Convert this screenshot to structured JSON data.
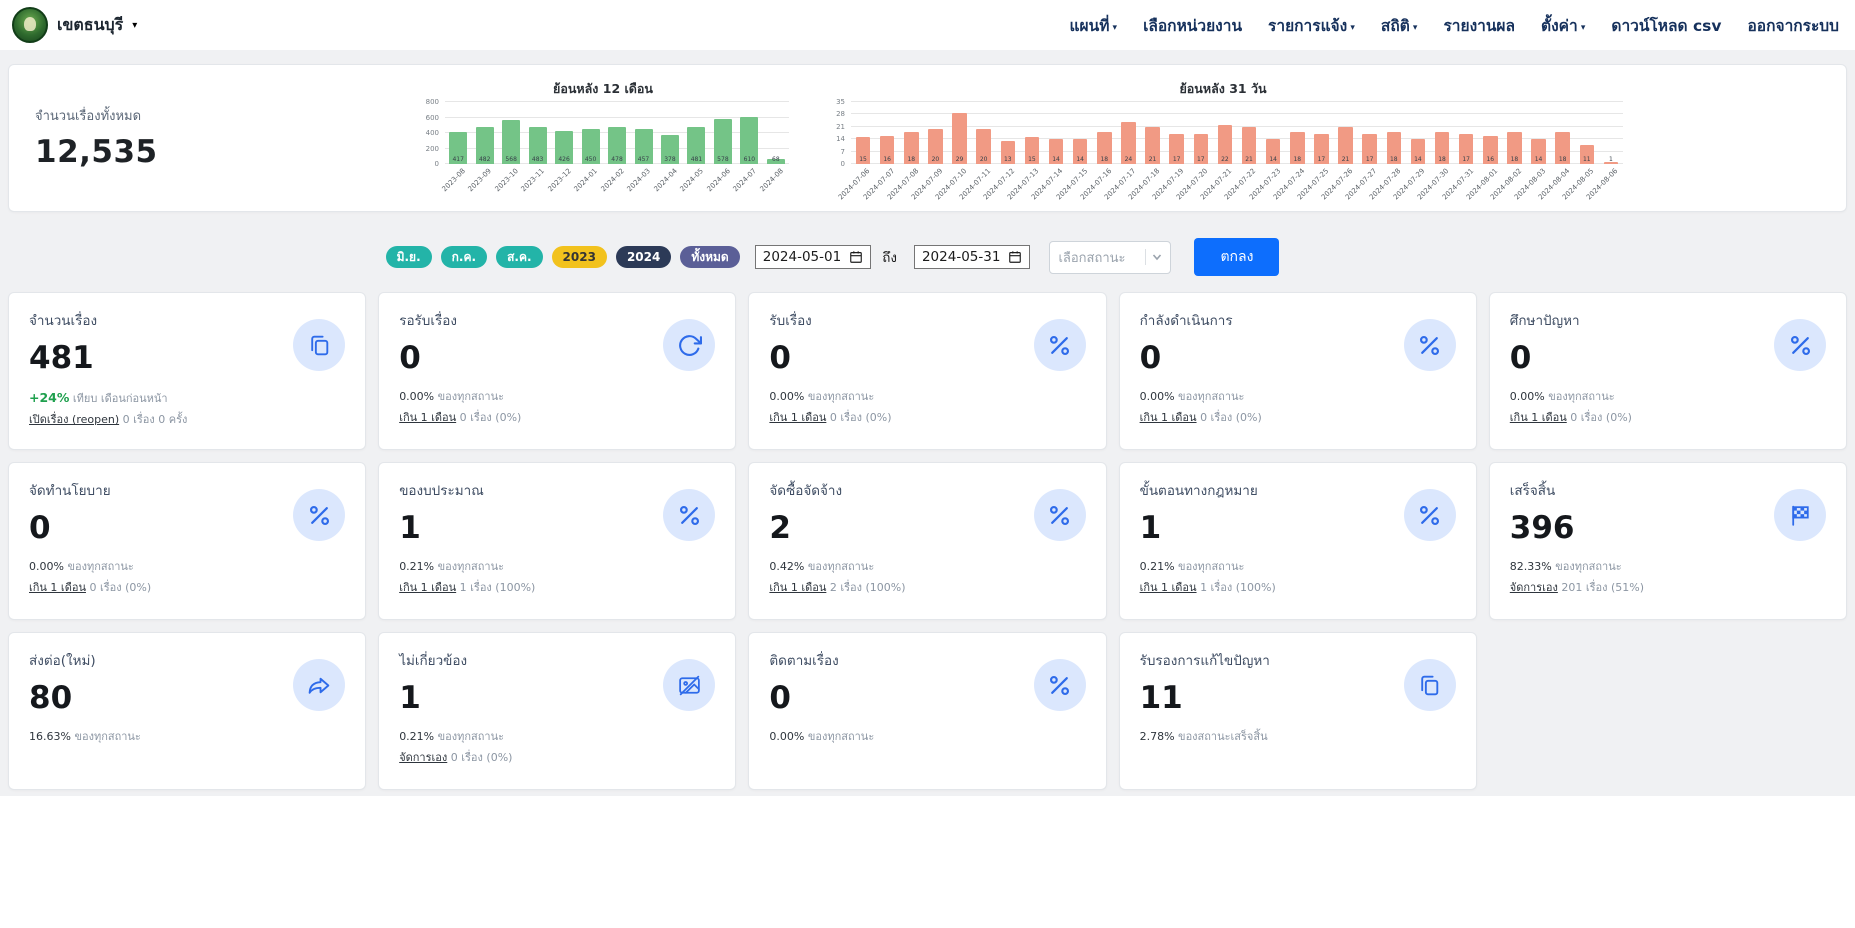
{
  "navbar": {
    "brand": "เขตธนบุรี",
    "items": [
      {
        "label": "แผนที่",
        "caret": true
      },
      {
        "label": "เลือกหน่วยงาน",
        "caret": false
      },
      {
        "label": "รายการแจ้ง",
        "caret": true
      },
      {
        "label": "สถิติ",
        "caret": true
      },
      {
        "label": "รายงานผล",
        "caret": false
      },
      {
        "label": "ตั้งค่า",
        "caret": true
      },
      {
        "label": "ดาวน์โหลด csv",
        "caret": false
      },
      {
        "label": "ออกจากระบบ",
        "caret": false
      }
    ]
  },
  "overview": {
    "total_label": "จำนวนเรื่องทั้งหมด",
    "total_value": "12,535"
  },
  "chart_data": [
    {
      "type": "bar",
      "title": "ย้อนหลัง 12 เดือน",
      "categories": [
        "2023-08",
        "2023-09",
        "2023-10",
        "2023-11",
        "2023-12",
        "2024-01",
        "2024-02",
        "2024-03",
        "2024-04",
        "2024-05",
        "2024-06",
        "2024-07",
        "2024-08"
      ],
      "values": [
        417,
        482,
        568,
        483,
        426,
        450,
        478,
        457,
        378,
        481,
        578,
        610,
        68
      ],
      "ylim": [
        0,
        800
      ],
      "yticks": [
        0,
        200,
        400,
        600,
        800
      ],
      "color": "#74c487",
      "grid": true,
      "legend": "none"
    },
    {
      "type": "bar",
      "title": "ย้อนหลัง 31 วัน",
      "categories": [
        "2024-07-06",
        "2024-07-07",
        "2024-07-08",
        "2024-07-09",
        "2024-07-10",
        "2024-07-11",
        "2024-07-12",
        "2024-07-13",
        "2024-07-14",
        "2024-07-15",
        "2024-07-16",
        "2024-07-17",
        "2024-07-18",
        "2024-07-19",
        "2024-07-20",
        "2024-07-21",
        "2024-07-22",
        "2024-07-23",
        "2024-07-24",
        "2024-07-25",
        "2024-07-26",
        "2024-07-27",
        "2024-07-28",
        "2024-07-29",
        "2024-07-30",
        "2024-07-31",
        "2024-08-01",
        "2024-08-02",
        "2024-08-03",
        "2024-08-04",
        "2024-08-05",
        "2024-08-06"
      ],
      "values": [
        15,
        16,
        18,
        20,
        29,
        20,
        13,
        15,
        14,
        14,
        18,
        24,
        21,
        17,
        17,
        22,
        21,
        14,
        18,
        17,
        21,
        17,
        18,
        14,
        18,
        17,
        16,
        18,
        14,
        18,
        11,
        1
      ],
      "ylim": [
        0,
        35
      ],
      "yticks": [
        0,
        7,
        14,
        21,
        28,
        35
      ],
      "color": "#f19a84",
      "grid": true,
      "legend": "none"
    }
  ],
  "filters": {
    "months": [
      "มิ.ย.",
      "ก.ค.",
      "ส.ค."
    ],
    "year2023": "2023",
    "year2024": "2024",
    "all": "ทั้งหมด",
    "date_from": "2024-05-01",
    "to_label": "ถึง",
    "date_to": "2024-05-31",
    "status_placeholder": "เลือกสถานะ",
    "submit_label": "ตกลง"
  },
  "cards": [
    {
      "title": "จำนวนเรื่อง",
      "value": "481",
      "icon": "pages-icon",
      "trend": "+24%",
      "trend_note": "เทียบ เดือนก่อนหน้า",
      "link": "เปิดเรื่อง (reopen)",
      "link_note": "0 เรื่อง 0 ครั้ง"
    },
    {
      "title": "รอรับเรื่อง",
      "value": "0",
      "icon": "refresh-icon",
      "pct": "0.00%",
      "pct_note": "ของทุกสถานะ",
      "link": "เกิน 1 เดือน",
      "link_note": "0 เรื่อง (0%)"
    },
    {
      "title": "รับเรื่อง",
      "value": "0",
      "icon": "percent-icon",
      "pct": "0.00%",
      "pct_note": "ของทุกสถานะ",
      "link": "เกิน 1 เดือน",
      "link_note": "0 เรื่อง (0%)"
    },
    {
      "title": "กำลังดำเนินการ",
      "value": "0",
      "icon": "percent-icon",
      "pct": "0.00%",
      "pct_note": "ของทุกสถานะ",
      "link": "เกิน 1 เดือน",
      "link_note": "0 เรื่อง (0%)"
    },
    {
      "title": "ศึกษาปัญหา",
      "value": "0",
      "icon": "percent-icon",
      "pct": "0.00%",
      "pct_note": "ของทุกสถานะ",
      "link": "เกิน 1 เดือน",
      "link_note": "0 เรื่อง (0%)"
    },
    {
      "title": "จัดทำนโยบาย",
      "value": "0",
      "icon": "percent-icon",
      "pct": "0.00%",
      "pct_note": "ของทุกสถานะ",
      "link": "เกิน 1 เดือน",
      "link_note": "0 เรื่อง (0%)"
    },
    {
      "title": "ของบประมาณ",
      "value": "1",
      "icon": "percent-icon",
      "pct": "0.21%",
      "pct_note": "ของทุกสถานะ",
      "link": "เกิน 1 เดือน",
      "link_note": "1 เรื่อง (100%)"
    },
    {
      "title": "จัดซื้อจัดจ้าง",
      "value": "2",
      "icon": "percent-icon",
      "pct": "0.42%",
      "pct_note": "ของทุกสถานะ",
      "link": "เกิน 1 เดือน",
      "link_note": "2 เรื่อง (100%)"
    },
    {
      "title": "ขั้นตอนทางกฎหมาย",
      "value": "1",
      "icon": "percent-icon",
      "pct": "0.21%",
      "pct_note": "ของทุกสถานะ",
      "link": "เกิน 1 เดือน",
      "link_note": "1 เรื่อง (100%)"
    },
    {
      "title": "เสร็จสิ้น",
      "value": "396",
      "icon": "flag-icon",
      "pct": "82.33%",
      "pct_note": "ของทุกสถานะ",
      "link": "จัดการเอง",
      "link_note": "201 เรื่อง (51%)"
    },
    {
      "title": "ส่งต่อ(ใหม่)",
      "value": "80",
      "icon": "share-icon",
      "pct": "16.63%",
      "pct_note": "ของทุกสถานะ"
    },
    {
      "title": "ไม่เกี่ยวข้อง",
      "value": "1",
      "icon": "not-related-icon",
      "pct": "0.21%",
      "pct_note": "ของทุกสถานะ",
      "link": "จัดการเอง",
      "link_note": "0 เรื่อง (0%)"
    },
    {
      "title": "ติดตามเรื่อง",
      "value": "0",
      "icon": "percent-icon",
      "pct": "0.00%",
      "pct_note": "ของทุกสถานะ"
    },
    {
      "title": "รับรองการแก้ไขปัญหา",
      "value": "11",
      "icon": "pages-icon",
      "pct": "2.78%",
      "pct_note": "ของสถานะเสร็จสิ้น"
    }
  ]
}
